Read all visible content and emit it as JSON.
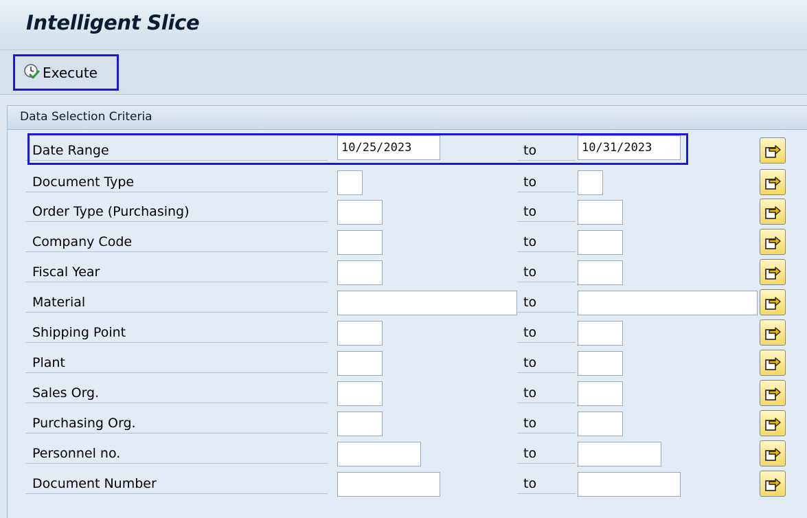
{
  "title": "Intelligent Slice",
  "toolbar": {
    "execute_label": "Execute"
  },
  "panel": {
    "title": "Data Selection Criteria"
  },
  "to_label": "to",
  "rows": [
    {
      "label": "Date Range",
      "low": "10/25/2023",
      "high": "10/31/2023"
    },
    {
      "label": "Document Type",
      "low": "",
      "high": ""
    },
    {
      "label": "Order Type (Purchasing)",
      "low": "",
      "high": ""
    },
    {
      "label": "Company Code",
      "low": "",
      "high": ""
    },
    {
      "label": "Fiscal Year",
      "low": "",
      "high": ""
    },
    {
      "label": "Material",
      "low": "",
      "high": ""
    },
    {
      "label": "Shipping Point",
      "low": "",
      "high": ""
    },
    {
      "label": "Plant",
      "low": "",
      "high": ""
    },
    {
      "label": "Sales Org.",
      "low": "",
      "high": ""
    },
    {
      "label": "Purchasing Org.",
      "low": "",
      "high": ""
    },
    {
      "label": "Personnel no.",
      "low": "",
      "high": ""
    },
    {
      "label": "Document Number",
      "low": "",
      "high": ""
    }
  ],
  "icons": {
    "execute": "execute-clock-icon",
    "multiple_selection": "multiple-selection-arrow-icon"
  },
  "colors": {
    "highlight": "#1818e0",
    "background": "#dfe8f1",
    "multi_button": "#f6d860"
  }
}
